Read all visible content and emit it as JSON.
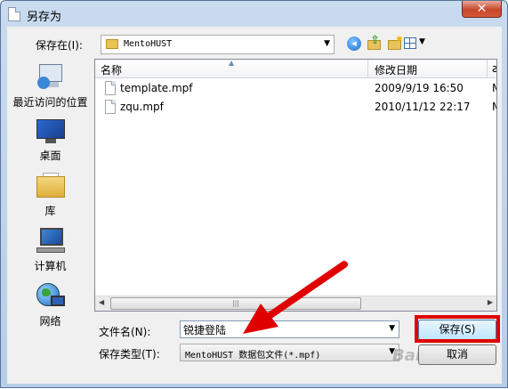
{
  "window": {
    "title": "另存为",
    "close_glyph": "✕"
  },
  "save_in": {
    "label": "保存在(I):",
    "value": "MentoHUST"
  },
  "places": [
    {
      "label": "最近访问的位置",
      "icon": "recent-places-icon"
    },
    {
      "label": "桌面",
      "icon": "desktop-icon"
    },
    {
      "label": "库",
      "icon": "libraries-icon"
    },
    {
      "label": "计算机",
      "icon": "computer-icon"
    },
    {
      "label": "网络",
      "icon": "network-icon"
    }
  ],
  "columns": {
    "name": "名称",
    "date": "修改日期",
    "third": "ƨ"
  },
  "files": [
    {
      "name": "template.mpf",
      "date": "2009/9/19 16:50",
      "third": "M"
    },
    {
      "name": "zqu.mpf",
      "date": "2010/11/12 22:17",
      "third": "M"
    }
  ],
  "filename": {
    "label": "文件名(N):",
    "value": "锐捷登陆"
  },
  "filetype": {
    "label": "保存类型(T):",
    "value": "MentoHUST 数据包文件(*.mpf)"
  },
  "buttons": {
    "save": "保存(S)",
    "cancel": "取消"
  },
  "watermark": "Baidu",
  "annotation_color": "#e00000"
}
